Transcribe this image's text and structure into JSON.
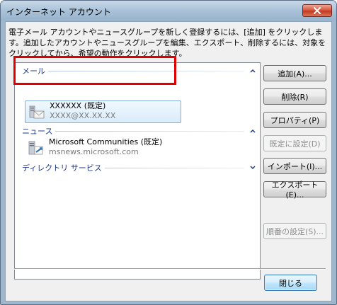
{
  "window": {
    "title": "インターネット アカウント"
  },
  "description": "電子メール アカウントやニュースグループを新しく登録するには、[追加] をクリックします。追加したアカウントやニュースグループを編集、エクスポート、削除するには、対象をクリックしてから、希望の動作をクリックします。",
  "list": {
    "groups": [
      {
        "label": "メール",
        "chevron": "up"
      },
      {
        "label": "ニュース",
        "chevron": "up"
      },
      {
        "label": "ディレクトリ サービス",
        "chevron": "down"
      }
    ],
    "mail_account": {
      "name": "XXXXXX (既定)",
      "address": "XXXX@XX.XX.XX"
    },
    "news_account": {
      "name": "Microsoft Communities (既定)",
      "server": "msnews.microsoft.com"
    }
  },
  "buttons": {
    "add": "追加(A)...",
    "remove": "削除(R)",
    "properties": "プロパティ(P)",
    "set_default": "既定に設定(D)",
    "import": "インポート(I)...",
    "export": "エクスポート(E)...",
    "order": "順番の設定(S)...",
    "close": "閉じる"
  },
  "colors": {
    "highlight": "#e00000",
    "group_header": "#1e3a8a",
    "selection": "#d8ecfa"
  }
}
